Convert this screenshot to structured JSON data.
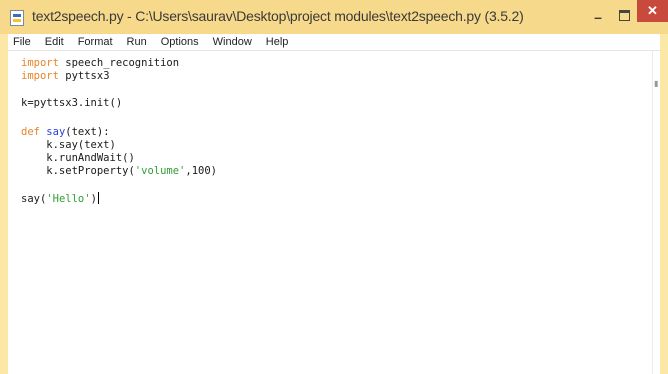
{
  "window": {
    "title": "text2speech.py - C:\\Users\\saurav\\Desktop\\project modules\\text2speech.py (3.5.2)",
    "minimize_glyph": "–",
    "close_glyph": "✕",
    "app_icon": "python-file-icon",
    "accent_color": "#f7d98b",
    "close_color": "#c74a3c"
  },
  "menu": {
    "items": [
      "File",
      "Edit",
      "Format",
      "Run",
      "Options",
      "Window",
      "Help"
    ]
  },
  "editor": {
    "lines": {
      "l1_kw": "import",
      "l1_rest": " speech_recognition",
      "l2_kw": "import",
      "l2_rest": " pyttsx3",
      "l4": "k=pyttsx3.init()",
      "l6_kw": "def",
      "l6_fn": "say",
      "l6_rest": "(text):",
      "l7": "    k.say(text)",
      "l8": "    k.runAndWait()",
      "l9_pre": "    k.setProperty(",
      "l9_str": "'volume'",
      "l9_post": ",100)",
      "l11_pre": "say(",
      "l11_str": "'Hello'",
      "l11_post": ")"
    },
    "syntax_colors": {
      "keyword": "#e8842a",
      "function": "#2a3fd0",
      "string": "#2e9e36"
    }
  }
}
